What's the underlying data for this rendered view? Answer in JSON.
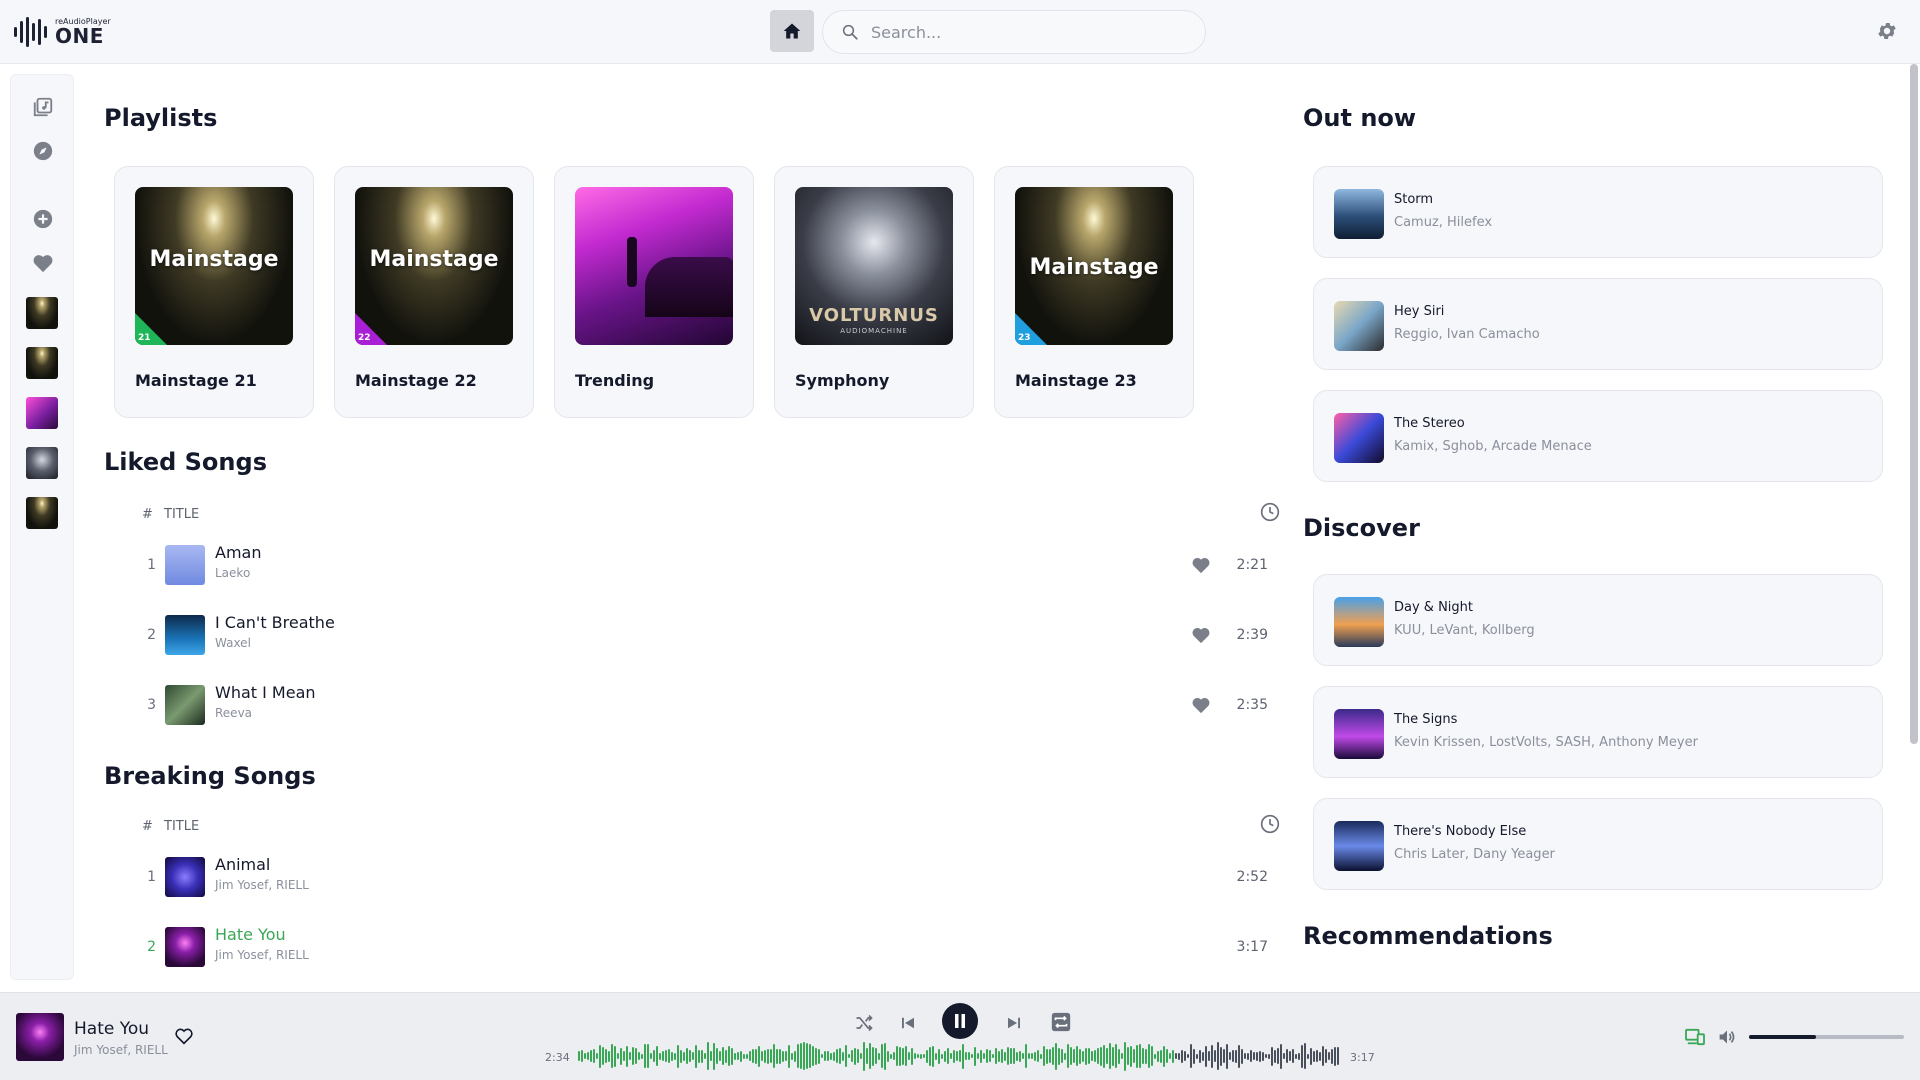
{
  "app": {
    "logo_small": "reAudioPlayer",
    "logo_big": "ONE",
    "search_placeholder": "Search..."
  },
  "sections": {
    "playlists": "Playlists",
    "liked": "Liked Songs",
    "breaking": "Breaking Songs",
    "out_now": "Out now",
    "discover": "Discover",
    "recommendations": "Recommendations"
  },
  "playlists": [
    {
      "name": "Mainstage 21",
      "cover_text": "Mainstage",
      "badge": "21",
      "badge_color": "#1fb65a"
    },
    {
      "name": "Mainstage 22",
      "cover_text": "Mainstage",
      "badge": "22",
      "badge_color": "#a81fd6"
    },
    {
      "name": "Trending",
      "cover_text": "",
      "badge": "",
      "badge_color": ""
    },
    {
      "name": "Symphony",
      "cover_text": "VOLTURNUS",
      "cover_sub": "AUDIOMACHINE",
      "badge": "",
      "badge_color": ""
    },
    {
      "name": "Mainstage 23",
      "cover_text": "Mainstage",
      "badge": "23",
      "badge_color": "#1f9ee0"
    }
  ],
  "table": {
    "hash": "#",
    "title_header": "TITLE"
  },
  "liked_songs": [
    {
      "num": "1",
      "title": "Aman",
      "artist": "Laeko",
      "duration": "2:21"
    },
    {
      "num": "2",
      "title": "I Can't Breathe",
      "artist": "Waxel",
      "duration": "2:39"
    },
    {
      "num": "3",
      "title": "What I Mean",
      "artist": "Reeva",
      "duration": "2:35"
    }
  ],
  "breaking_songs": [
    {
      "num": "1",
      "title": "Animal",
      "artist": "Jim Yosef, RIELL",
      "duration": "2:52",
      "playing": false
    },
    {
      "num": "2",
      "title": "Hate You",
      "artist": "Jim Yosef, RIELL",
      "duration": "3:17",
      "playing": true
    }
  ],
  "out_now": [
    {
      "title": "Storm",
      "artist": "Camuz, Hilefex"
    },
    {
      "title": "Hey Siri",
      "artist": "Reggio, Ivan Camacho"
    },
    {
      "title": "The Stereo",
      "artist": "Kamix, Sghob, Arcade Menace"
    }
  ],
  "discover": [
    {
      "title": "Day & Night",
      "artist": "KUU, LeVant, Kollberg"
    },
    {
      "title": "The Signs",
      "artist": "Kevin Krissen, LostVolts, SASH, Anthony Meyer"
    },
    {
      "title": "There's Nobody Else",
      "artist": "Chris Later, Dany Yeager"
    }
  ],
  "player": {
    "title": "Hate You",
    "artist": "Jim Yosef, RIELL",
    "elapsed": "2:34",
    "total": "3:17",
    "progress": 0.785,
    "volume": 0.43
  },
  "colors": {
    "accent_green": "#3aa757",
    "wave_played": "#3aa757",
    "wave_remaining": "#4a4f5c",
    "text_dark": "#14192b"
  }
}
